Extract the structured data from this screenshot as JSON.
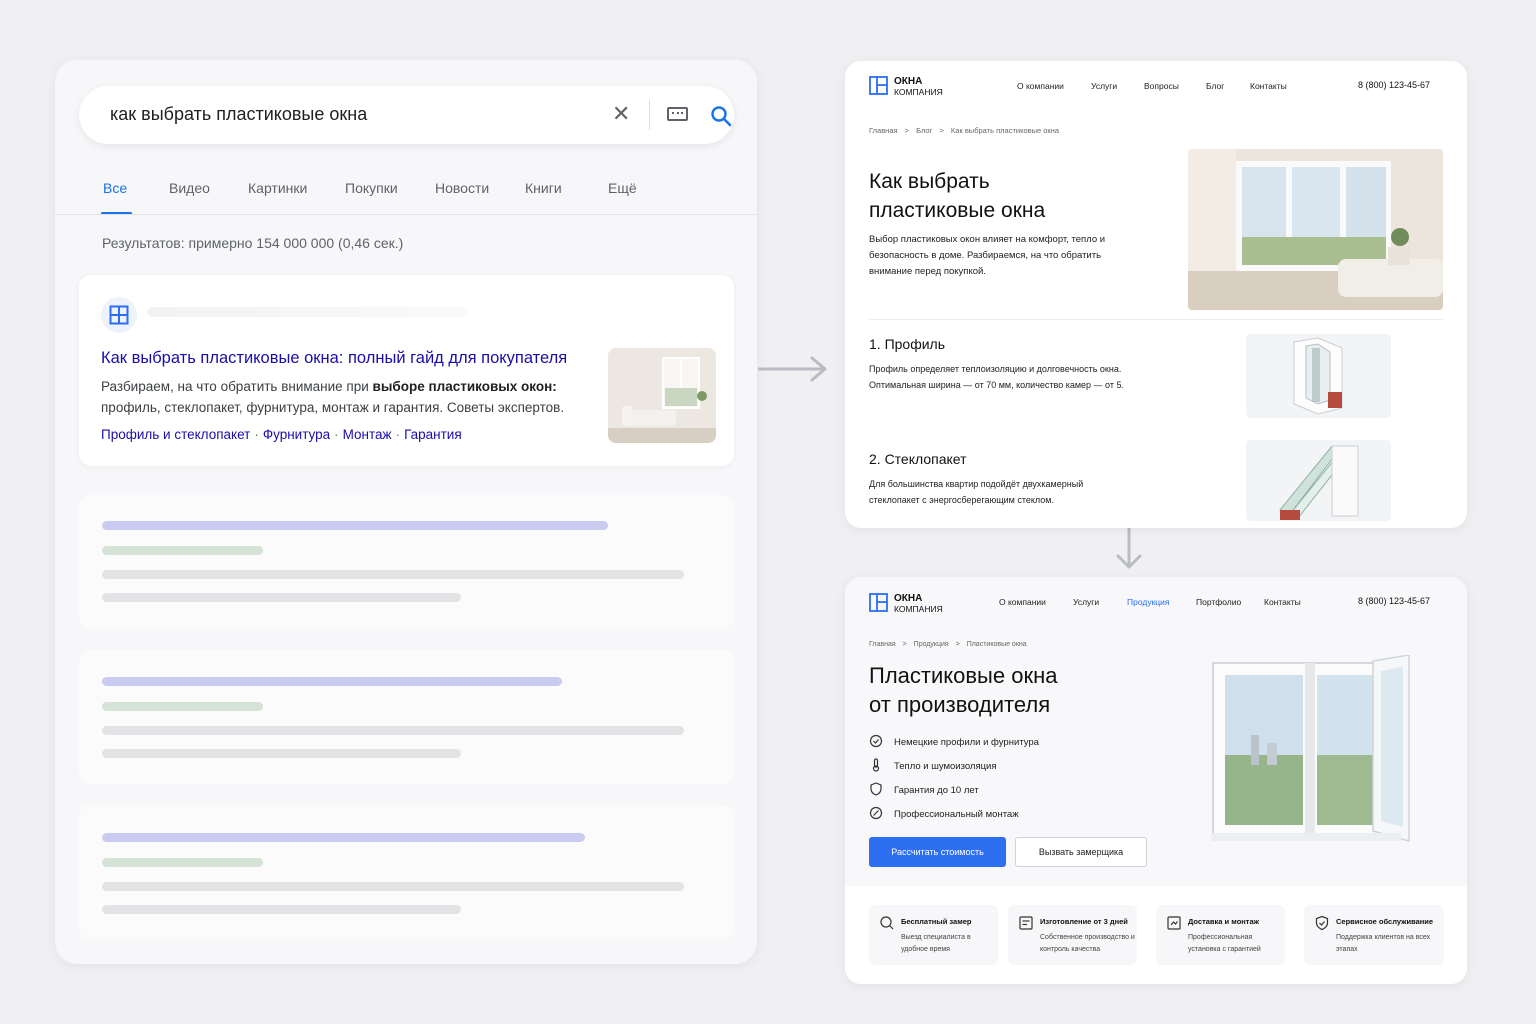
{
  "serp": {
    "query": "как выбрать пластиковые окна",
    "tabs": [
      "Все",
      "Видео",
      "Картинки",
      "Покупки",
      "Новости",
      "Книги",
      "Ещё"
    ],
    "active_tab": "Все",
    "stats": "Результатов: примерно 154 000 000 (0,46 сек.)",
    "result": {
      "title": "Как выбрать пластиковые окна: полный гайд для покупателя",
      "snippet_before": "Разбираем, на что обратить внимание при ",
      "snippet_bold": "выборе пластиковых окон:",
      "snippet_after": " профиль, стеклопакет, фурнитура, монтаж и гарантия. Советы экспертов.",
      "links": [
        "Профиль и стеклопакет",
        "Фурнитура",
        "Монтаж",
        "Гарантия"
      ],
      "link_separator": "·"
    },
    "colors": {
      "link": "#1a0dab",
      "accent": "#1a73e8"
    }
  },
  "site_blog": {
    "logo_line1": "ОКНА",
    "logo_line2": "КОМПАНИЯ",
    "nav": [
      "О компании",
      "Услуги",
      "Вопросы",
      "Блог",
      "Контакты"
    ],
    "phone": "8 (800) 123-45-67",
    "breadcrumb": [
      "Главная",
      "Блог",
      "Как выбрать пластиковые окна"
    ],
    "breadcrumb_sep": ">",
    "title_line1": "Как выбрать",
    "title_line2": "пластиковые окна",
    "intro": "Выбор пластиковых окон влияет на комфорт, тепло и безопасность в доме. Разбираемся, на что обратить внимание перед покупкой.",
    "sections": [
      {
        "heading": "1. Профиль",
        "text": "Профиль определяет теплоизоляцию и долговечность окна. Оптимальная ширина — от 70 мм, количество камер — от 5."
      },
      {
        "heading": "2. Стеклопакет",
        "text": "Для большинства квартир подойдёт двухкамерный стеклопакет с энергосберегающим стеклом."
      }
    ]
  },
  "site_product": {
    "logo_line1": "ОКНА",
    "logo_line2": "КОМПАНИЯ",
    "nav": [
      "О компании",
      "Услуги",
      "Продукция",
      "Портфолио",
      "Контакты"
    ],
    "nav_active": "Продукция",
    "phone": "8 (800) 123-45-67",
    "breadcrumb": [
      "Главная",
      "Продукция",
      "Пластиковые окна"
    ],
    "breadcrumb_sep": ">",
    "title_line1": "Пластиковые окна",
    "title_line2": "от производителя",
    "features": [
      "Немецкие профили и фурнитура",
      "Тепло и шумоизоляция",
      "Гарантия до 10 лет",
      "Профессиональный монтаж"
    ],
    "primary_button": "Рассчитать стоимость",
    "secondary_button": "Вызвать замерщика",
    "cards": [
      {
        "title": "Бесплатный замер",
        "desc": "Выезд специалиста в удобное время"
      },
      {
        "title": "Изготовление от 3 дней",
        "desc": "Собственное производство и контроль качества"
      },
      {
        "title": "Доставка и монтаж",
        "desc": "Профессиональная установка с гарантией"
      },
      {
        "title": "Сервисное обслуживание",
        "desc": "Поддержка клиентов на всех этапах"
      }
    ],
    "colors": {
      "accent": "#2e6ff2"
    }
  }
}
